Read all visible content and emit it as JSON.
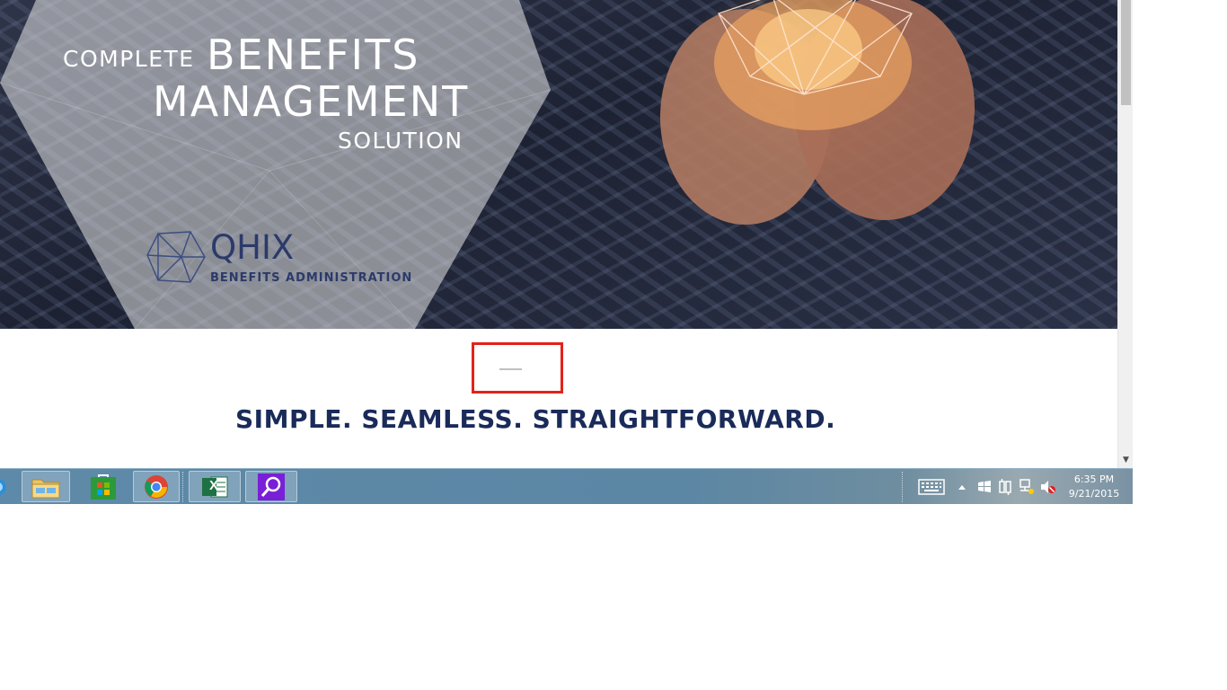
{
  "hero": {
    "line1": "COMPLETE",
    "line2": "BENEFITS",
    "line3": "MANAGEMENT",
    "line4": "SOLUTION",
    "logo_name": "QHIX",
    "logo_subtitle": "BENEFITS ADMINISTRATION"
  },
  "content": {
    "tagline": "SIMPLE. SEAMLESS. STRAIGHTFORWARD."
  },
  "scrollbar": {
    "down_arrow": "▼"
  },
  "taskbar": {
    "apps": [
      {
        "name": "Internet Explorer",
        "icon": "ie-icon"
      },
      {
        "name": "File Explorer",
        "icon": "folder-icon"
      },
      {
        "name": "Store",
        "icon": "store-icon"
      },
      {
        "name": "Google Chrome",
        "icon": "chrome-icon"
      },
      {
        "name": "Excel",
        "icon": "excel-icon",
        "letter": "X"
      },
      {
        "name": "Search",
        "icon": "search-icon"
      }
    ],
    "clock_time": "6:35 PM",
    "clock_date": "9/21/2015"
  },
  "colors": {
    "tagline": "#1a2b5a",
    "highlight": "#e2231a",
    "logo": "#2b3a6a"
  }
}
